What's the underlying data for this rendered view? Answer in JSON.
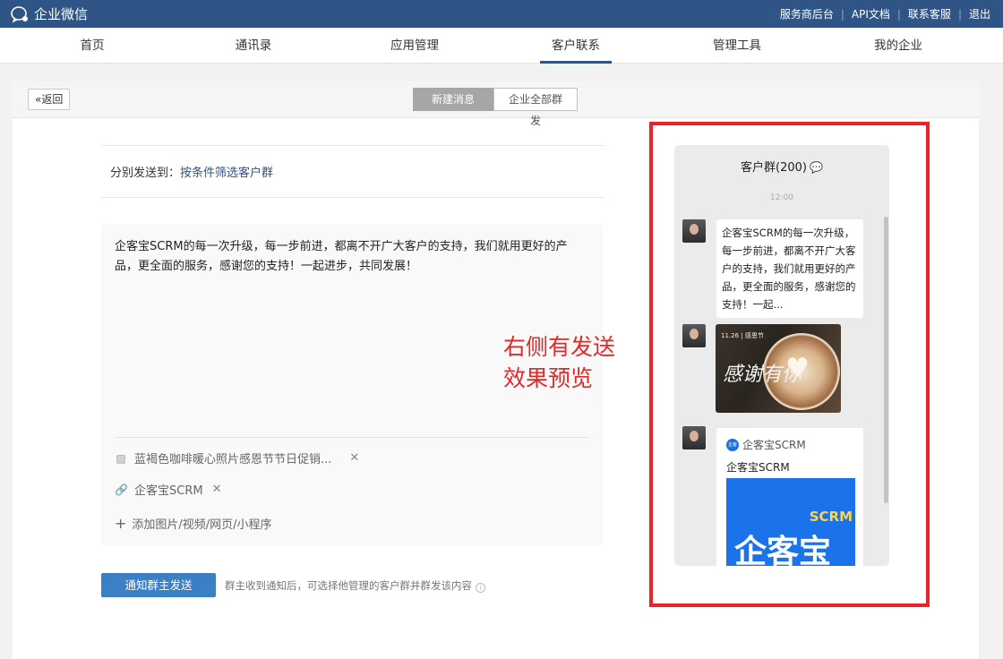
{
  "app": {
    "name": "企业微信"
  },
  "top_links": [
    "服务商后台",
    "API文档",
    "联系客服",
    "退出"
  ],
  "nav": [
    {
      "label": "首页",
      "active": false
    },
    {
      "label": "通讯录",
      "active": false
    },
    {
      "label": "应用管理",
      "active": false
    },
    {
      "label": "客户联系",
      "active": true
    },
    {
      "label": "管理工具",
      "active": false
    },
    {
      "label": "我的企业",
      "active": false
    }
  ],
  "header": {
    "back_label": "返回",
    "tabs": [
      {
        "label": "新建消息",
        "active": true
      },
      {
        "label": "企业全部群发",
        "active": false
      }
    ]
  },
  "form": {
    "send_to_label": "分别发送到：",
    "send_to_value": "按条件筛选客户群",
    "message_text": "企客宝SCRM的每一次升级，每一步前进，都离不开广大客户的支持，我们就用更好的产品，更全面的服务，感谢您的支持！一起进步，共同发展！",
    "attachments": [
      {
        "type": "image",
        "icon": "image-icon",
        "label": "蓝褐色咖啡暖心照片感恩节节日促销..."
      },
      {
        "type": "link",
        "icon": "link-icon",
        "label": "企客宝SCRM"
      }
    ],
    "add_media_label": "添加图片/视频/网页/小程序",
    "notify_button": "通知群主发送",
    "notify_hint": "群主收到通知后，可选择他管理的客户群并群发该内容"
  },
  "annotation": {
    "line1": "右侧有发送",
    "line2": "效果预览"
  },
  "preview": {
    "title": "客户群(200)",
    "time": "12:00",
    "text_bubble": "企客宝SCRM的每一次升级，每一步前进，都离不开广大客户的支持，我们就用更好的产品，更全面的服务，感谢您的支持！一起...",
    "image_card": {
      "date": "11.26 | 感恩节",
      "calligraphy": "感谢有你"
    },
    "link_card": {
      "source": "企客宝SCRM",
      "badge": "企客宝",
      "title": "企客宝SCRM",
      "banner_small": "SCRM",
      "banner_big": "企客宝"
    }
  },
  "colors": {
    "topbar": "#2f5587",
    "primary_button": "#3b7fc4",
    "annotation_red": "#e32828"
  }
}
